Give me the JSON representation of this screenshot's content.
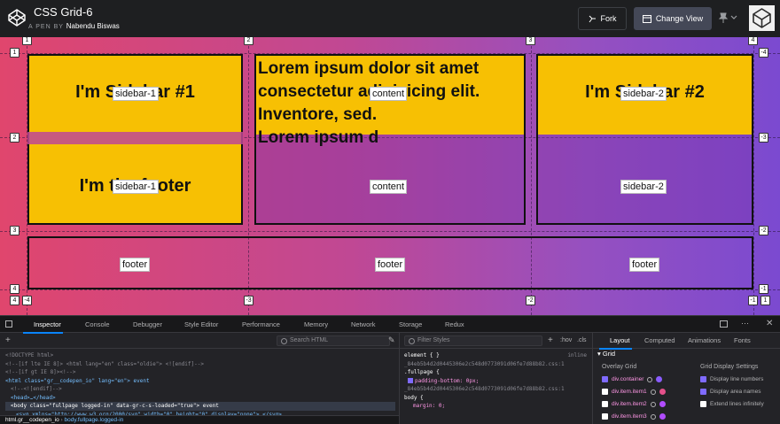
{
  "header": {
    "title": "CSS Grid-6",
    "pen_by_prefix": "A PEN BY",
    "author": "Nabendu Biswas",
    "fork_label": "Fork",
    "change_view_label": "Change View"
  },
  "preview": {
    "sidebar1_text": "I'm Sidebar #1",
    "sidebar1_footer_text": "I'm the footer",
    "sidebar2_text": "I'm Sidebar #2",
    "content_text": "Lorem ipsum dolor sit amet consectetur adipisicing elit. Inventore, sed.",
    "content_overflow_text": "Lorem ipsum d",
    "area_labels": {
      "sidebar1": "sidebar-1",
      "content": "content",
      "sidebar2": "sidebar-2",
      "footer": "footer"
    },
    "line_numbers": {
      "top": [
        "1",
        "2",
        "3",
        "4"
      ],
      "left": [
        "1",
        "2",
        "3",
        "4"
      ],
      "right": [
        "-4",
        "-3",
        "-2",
        "-1"
      ],
      "bottom": [
        "-4",
        "-3",
        "-2",
        "-1"
      ],
      "bottom_left": "4",
      "bottom_right": "1"
    }
  },
  "devtools": {
    "tabs": [
      "Inspector",
      "Console",
      "Debugger",
      "Style Editor",
      "Performance",
      "Memory",
      "Network",
      "Storage",
      "Redux"
    ],
    "active_tab": "Inspector",
    "search_html_placeholder": "Search HTML",
    "filter_styles_placeholder": "Filter Styles",
    "toggles": [
      ":hov",
      ".cls"
    ],
    "right_tabs": [
      "Layout",
      "Computed",
      "Animations",
      "Fonts"
    ],
    "active_right_tab": "Layout",
    "html_lines": [
      "<!DOCTYPE html>",
      "<!--[if lte IE 8]> <html lang=\"en\" class=\"oldie\"> <![endif]-->",
      "<!--[if gt IE 8]><!-->",
      "<html class=\"gr__codepen_io\" lang=\"en\"> event",
      "<!--<![endif]-->",
      "<head>…</head>",
      "<body class=\"fullpage logged-in\" data-gr-c-s-loaded=\"true\"> event",
      "<svg xmlns=\"http://www.w3.org/2000/svg\" width=\"0\" height=\"0\" display=\"none\">…</svg>"
    ],
    "breadcrumb_root": "html.gr__codepen_io",
    "breadcrumb_node": "body.fullpage.logged-in",
    "css_lines": [
      "element { }",
      "inline",
      "_84eb5b4d2d0445306e2c548d0773091d06fe7d88b82.css:1",
      ".fullpage {",
      "padding-bottom: 0px;",
      "_84eb5b4d2d0445306e2c548d0773091d06fe7d88b82.css:1",
      "body {",
      "margin: 0;"
    ],
    "layout": {
      "section": "Grid",
      "overlay_title": "Overlay Grid",
      "display_title": "Grid Display Settings",
      "overlay_items": [
        {
          "name": "div.container",
          "checked": true,
          "color": "#8a5cff"
        },
        {
          "name": "div.item.item1",
          "checked": false,
          "color": "#e4508a"
        },
        {
          "name": "div.item.item2",
          "checked": false,
          "color": "#b14cff"
        },
        {
          "name": "div.item.item3",
          "checked": false,
          "color": "#b14cff"
        }
      ],
      "display_items": [
        {
          "name": "Display line numbers",
          "checked": true
        },
        {
          "name": "Display area names",
          "checked": true
        },
        {
          "name": "Extend lines infinitely",
          "checked": false
        }
      ]
    }
  }
}
